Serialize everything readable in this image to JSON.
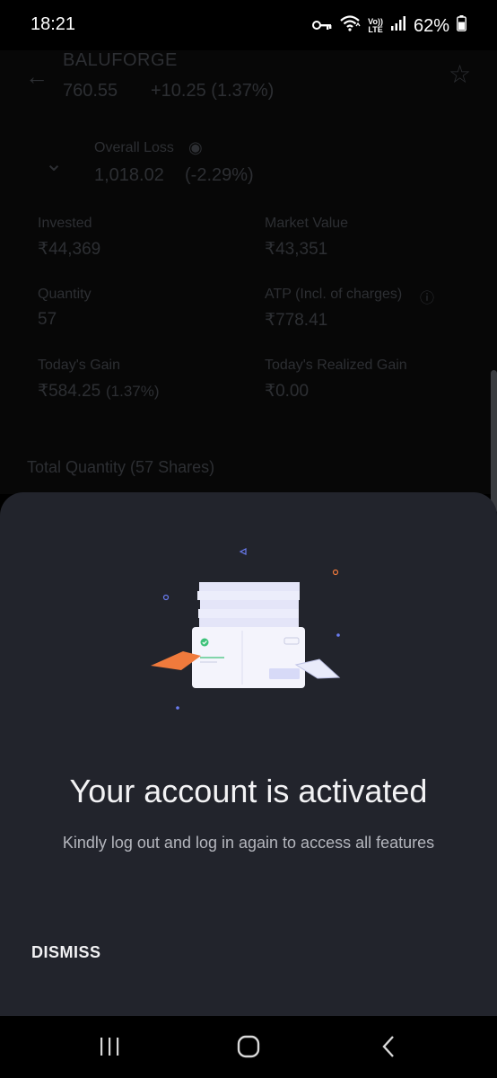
{
  "status_bar": {
    "time": "18:21",
    "battery_percent": "62%",
    "lte_top": "Vo))",
    "lte_bottom": "LTE",
    "icons": [
      "key-icon",
      "wifi-icon",
      "volte-icon",
      "signal-icon",
      "battery-icon"
    ]
  },
  "background_app": {
    "stock_name": "BALUFORGE",
    "price": "760.55",
    "change": "+10.25 (1.37%)",
    "overall_loss_label": "Overall Loss",
    "overall_loss_value": "1,018.02",
    "overall_loss_pct": "(-2.29%)",
    "stats": [
      {
        "label": "Invested",
        "value": "₹44,369"
      },
      {
        "label": "Market Value",
        "value": "₹43,351"
      },
      {
        "label": "Quantity",
        "value": "57"
      },
      {
        "label": "ATP (Incl. of charges)",
        "value": "₹778.41"
      },
      {
        "label": "Today's Gain",
        "value": "₹584.25",
        "extra": "(1.37%)"
      },
      {
        "label": "Today's Realized Gain",
        "value": "₹0.00"
      }
    ],
    "total_quantity": "Total Quantity (57 Shares)"
  },
  "sheet": {
    "title": "Your account is activated",
    "subtitle": "Kindly log out and log in again to access all features",
    "dismiss_label": "DISMISS"
  },
  "colors": {
    "sheet_bg": "#22242c",
    "accent_orange": "#f07a3c",
    "accent_green": "#3ec27a",
    "accent_blue": "#6a7cf0"
  }
}
